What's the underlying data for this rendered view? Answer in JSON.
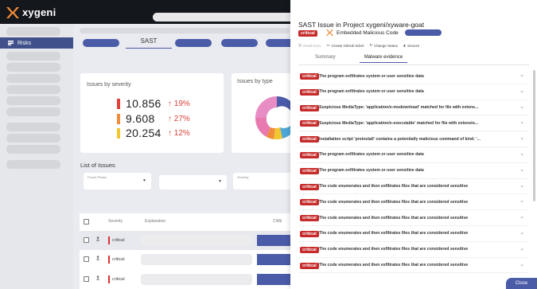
{
  "app": {
    "brand": "xygeni"
  },
  "sidebar": {
    "active_item": "Risks"
  },
  "main": {
    "active_tab": "SAST",
    "severity_card": {
      "title": "Issues by severity",
      "rows": [
        {
          "count": "10.856",
          "change": "↑ 19%",
          "color": "#e0403a"
        },
        {
          "count": "9.608",
          "change": "↑ 27%",
          "color": "#f08c3a"
        },
        {
          "count": "20.254",
          "change": "↑ 12%",
          "color": "#f1c62e"
        }
      ]
    },
    "type_card": {
      "title": "Issues by type"
    },
    "list": {
      "title": "List of Issues",
      "filters": {
        "found_phase": "Found Phase",
        "severity": "Severity"
      },
      "columns": {
        "severity": "Severity",
        "explanation": "Explanation",
        "cwe": "CWE"
      },
      "rows": [
        {
          "severity": "critical"
        },
        {
          "severity": "critical"
        },
        {
          "severity": "critical"
        }
      ]
    }
  },
  "panel": {
    "title": "SAST Issue in Project xygeni/xyware-goat",
    "severity": "critical",
    "issue_name": "Embedded Malicious Code",
    "actions": {
      "read_docs": "Read Docs",
      "github_ticket": "Create GitHub ticket",
      "change_status": "Change Status",
      "snooze": "Snooze"
    },
    "tabs": {
      "summary": "Summary",
      "malware": "Malware evidence"
    },
    "evidence": [
      {
        "badge": "critical",
        "text": "The program exfiltrates system or user sensitive data"
      },
      {
        "badge": "critical",
        "text": "The program exfiltrates system or user sensitive data"
      },
      {
        "badge": "critical",
        "text": "Suspicious MediaType: 'application/x-msdownload' matched for file with extens..."
      },
      {
        "badge": "critical",
        "text": "Suspicious MediaType: 'application/x-executable' matched for file with extensio..."
      },
      {
        "badge": "critical",
        "text": "Installation script 'preinstall' contains a potentially malicious command of kind: '..."
      },
      {
        "badge": "critical",
        "text": "The program exfiltrates system or user sensitive data"
      },
      {
        "badge": "critical",
        "text": "The program exfiltrates system or user sensitive data"
      },
      {
        "badge": "critical",
        "text": "The code enumerates and then exfiltrates files that are considered sensitive"
      },
      {
        "badge": "critical",
        "text": "The code enumerates and then exfiltrates files that are considered sensitive"
      },
      {
        "badge": "critical",
        "text": "The code enumerates and then exfiltrates files that are considered sensitive"
      },
      {
        "badge": "critical",
        "text": "The code enumerates and then exfiltrates files that are considered sensitive"
      },
      {
        "badge": "critical",
        "text": "The code enumerates and then exfiltrates files that are considered sensitive"
      },
      {
        "badge": "critical",
        "text": "The code enumerates and then exfiltrates files that are considered sensitive"
      }
    ],
    "close_label": "Close"
  },
  "colors": {
    "accent": "#4a5ba8",
    "critical": "#c62a2a",
    "topbar": "#14171c"
  }
}
